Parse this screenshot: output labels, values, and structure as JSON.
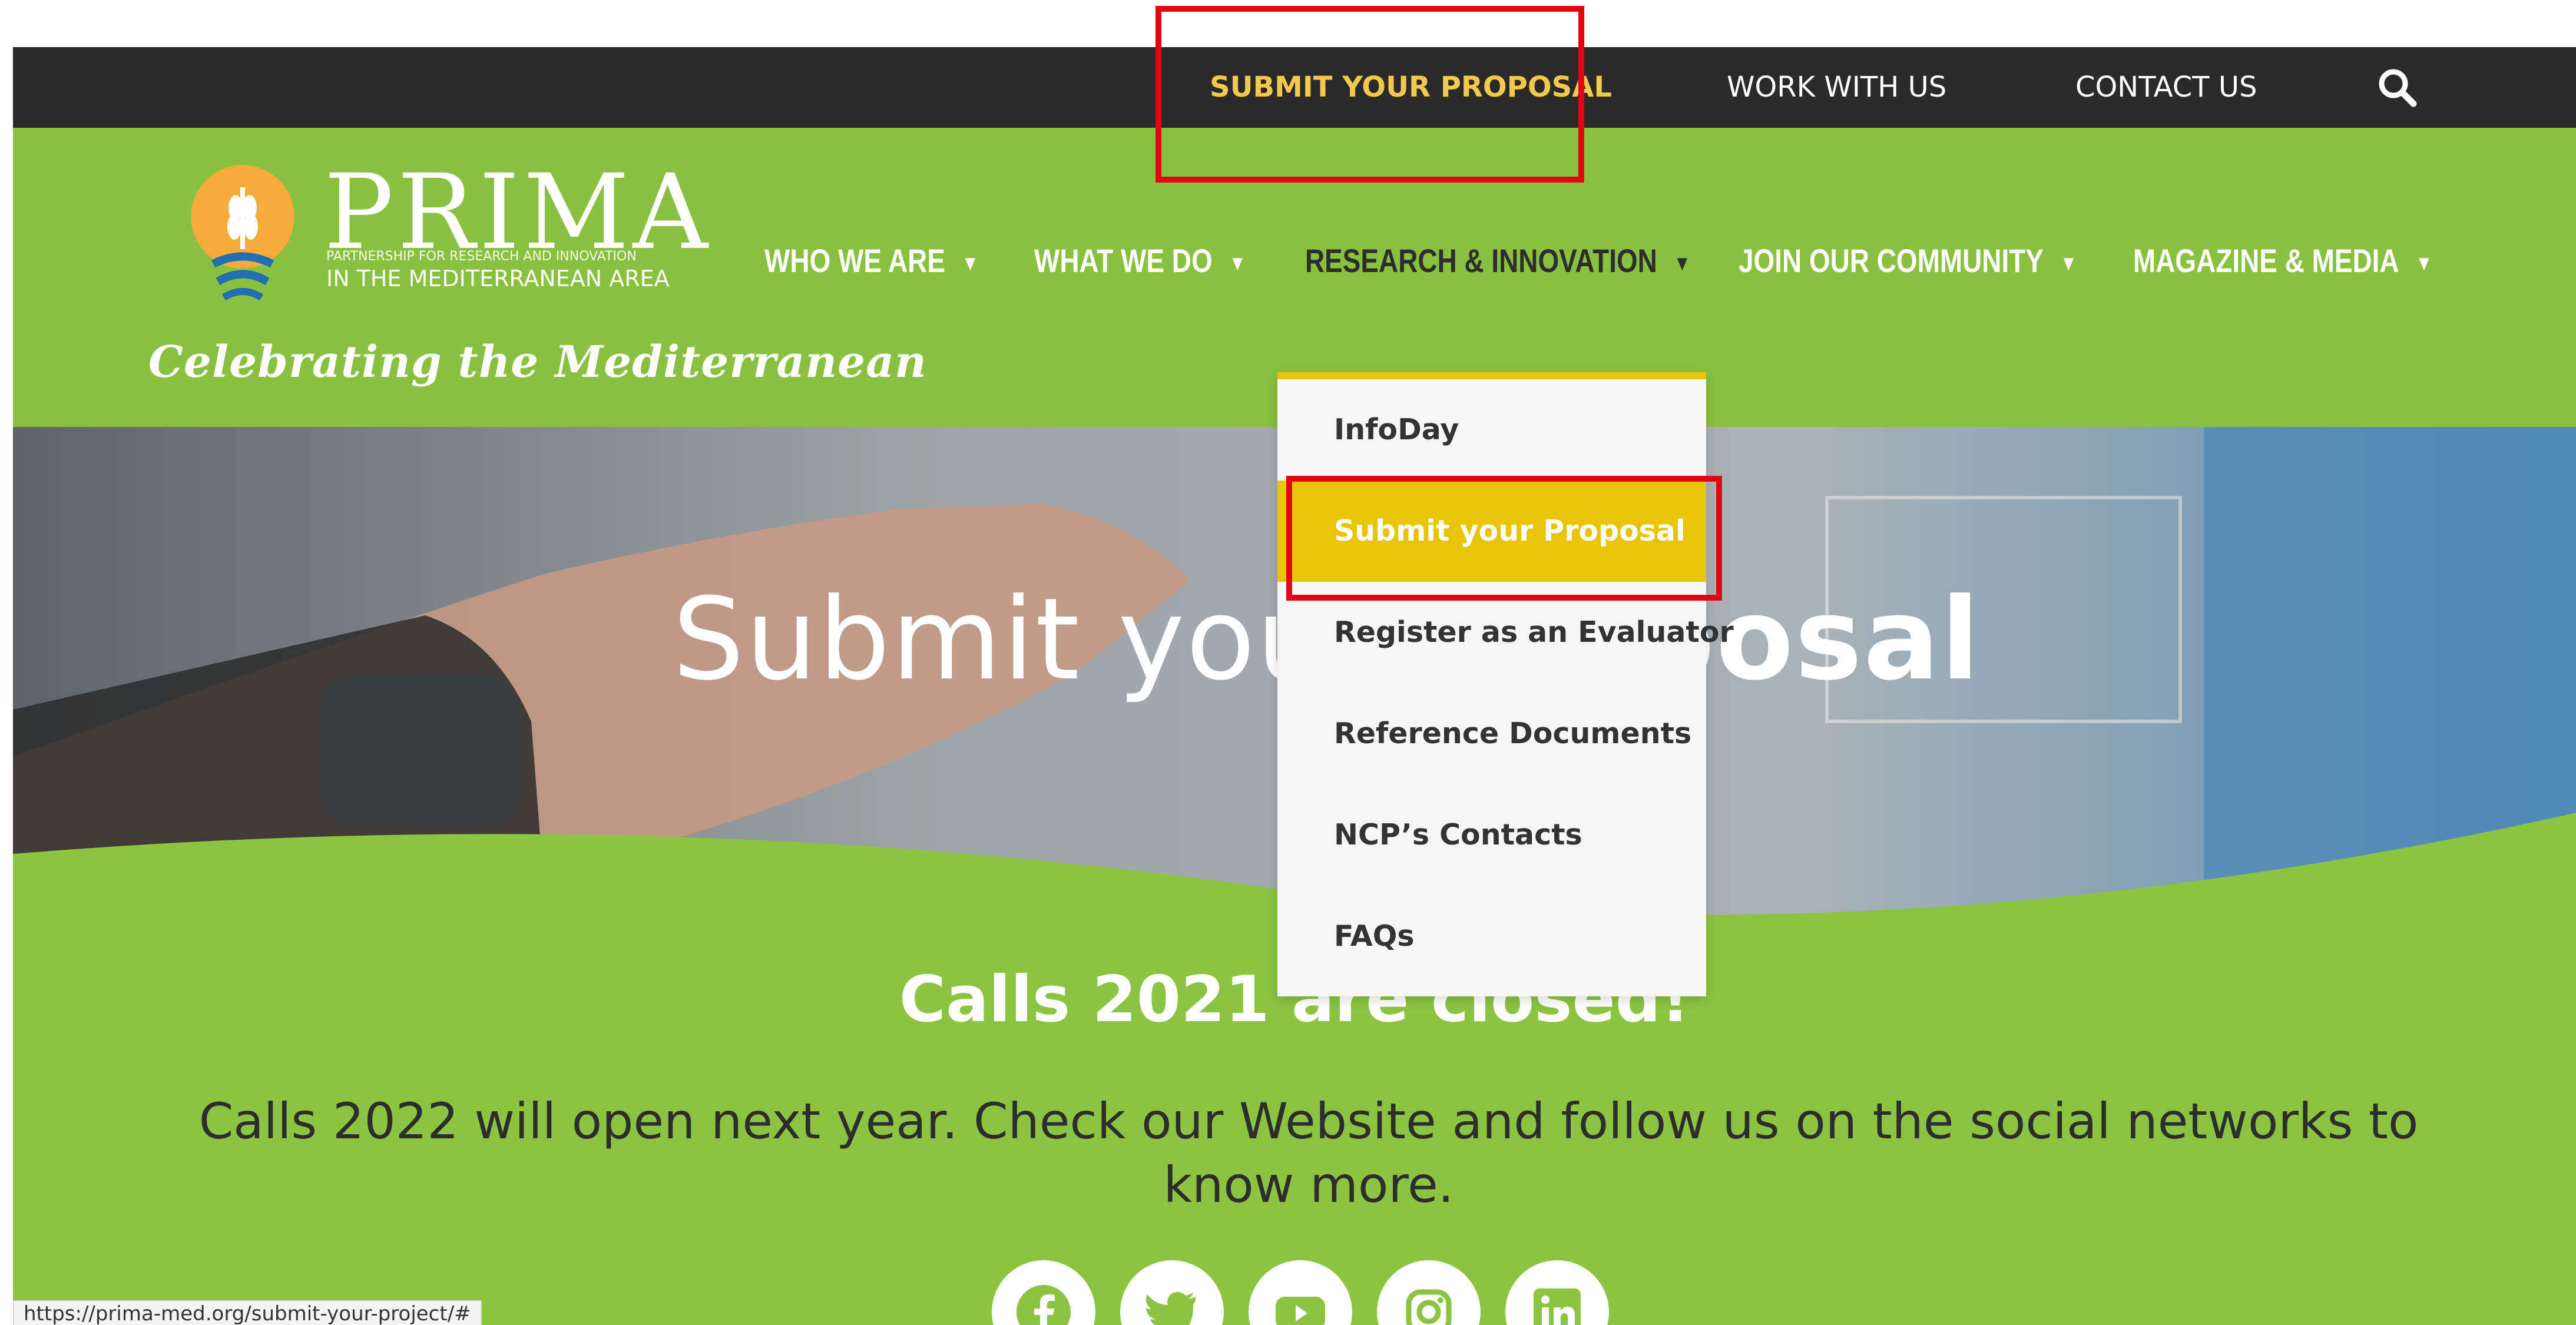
{
  "topbar": {
    "links": [
      "SUBMIT YOUR PROPOSAL",
      "WORK WITH US",
      "CONTACT US"
    ],
    "search_icon": "search-icon"
  },
  "logo": {
    "name": "PRIMA",
    "subtitle_small": "PARTNERSHIP FOR RESEARCH AND INNOVATION",
    "subtitle_large": "IN THE MEDITERRANEAN AREA",
    "tagline": "Celebrating the Mediterranean"
  },
  "nav": {
    "items": [
      "WHO WE ARE",
      "WHAT WE DO",
      "RESEARCH & INNOVATION",
      "JOIN OUR COMMUNITY",
      "MAGAZINE & MEDIA"
    ],
    "active": "RESEARCH & INNOVATION"
  },
  "hero": {
    "title_light": "Submit your ",
    "title_bold": "Proposal"
  },
  "dropdown": {
    "items": [
      "InfoDay",
      "Submit your Proposal",
      "Register as an Evaluator",
      "Reference Documents",
      "NCP’s Contacts",
      "FAQs"
    ],
    "active": "Submit your Proposal"
  },
  "content": {
    "calls_title": "Calls 2021 are closed!",
    "calls_text": "Calls 2022 will open next year. Check our Website and follow us on the social networks to know more."
  },
  "socials": [
    "facebook-icon",
    "twitter-icon",
    "youtube-icon",
    "instagram-icon",
    "linkedin-icon"
  ],
  "status_bar": {
    "url": "https://prima-med.org/submit-your-project/#"
  },
  "colors": {
    "topbar_bg": "#2a2a2a",
    "header_green": "#88c03f",
    "accent_yellow": "#e8c309",
    "highlight_text": "#f2c94c",
    "annotation_red": "#e20613"
  }
}
